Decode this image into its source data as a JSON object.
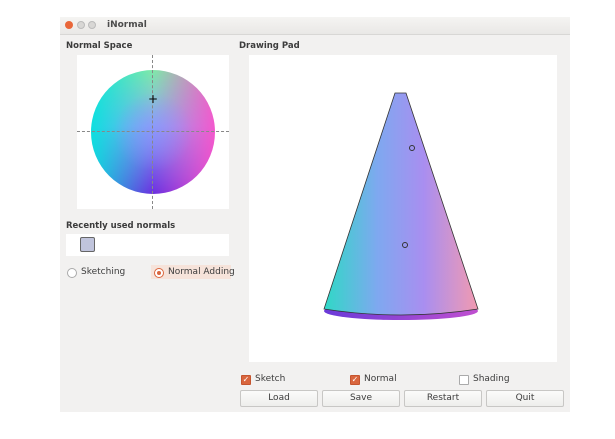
{
  "window": {
    "title": "iNormal"
  },
  "normal_space": {
    "label": "Normal Space"
  },
  "drawing_pad": {
    "label": "Drawing Pad"
  },
  "recent": {
    "label": "Recently used normals",
    "swatch_color": "#c0c4dc"
  },
  "modes": [
    {
      "label": "Sketching",
      "selected": false
    },
    {
      "label": "Normal Adding",
      "selected": true
    }
  ],
  "checks": [
    {
      "label": "Sketch",
      "checked": true
    },
    {
      "label": "Normal",
      "checked": true
    },
    {
      "label": "Shading",
      "checked": false
    }
  ],
  "buttons": [
    "Load",
    "Save",
    "Restart",
    "Quit"
  ],
  "accent": "#d9663e"
}
